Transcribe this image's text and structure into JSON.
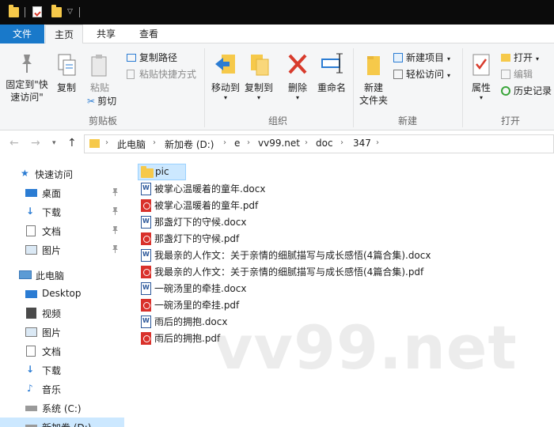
{
  "ribbon_tabs": {
    "file": "文件",
    "home": "主页",
    "share": "共享",
    "view": "查看"
  },
  "ribbon": {
    "clipboard": {
      "pin_label_1": "固定到\"快",
      "pin_label_2": "速访问\"",
      "copy": "复制",
      "paste": "粘贴",
      "copy_path": "复制路径",
      "paste_shortcut": "粘贴快捷方式",
      "cut": "剪切",
      "group": "剪贴板"
    },
    "organize": {
      "move_to": "移动到",
      "copy_to": "复制到",
      "delete": "删除",
      "rename": "重命名",
      "group": "组织"
    },
    "new": {
      "new_folder_1": "新建",
      "new_folder_2": "文件夹",
      "new_item": "新建项目",
      "easy_access": "轻松访问",
      "group": "新建"
    },
    "open": {
      "properties": "属性",
      "open": "打开",
      "edit": "编辑",
      "history": "历史记录",
      "group": "打开"
    }
  },
  "breadcrumbs": [
    "此电脑",
    "新加卷 (D:)",
    "e",
    "vv99.net",
    "doc",
    "347"
  ],
  "nav_pane": {
    "quick_access": "快速访问",
    "quick_items": [
      "桌面",
      "下载",
      "文档",
      "图片"
    ],
    "this_pc": "此电脑",
    "pc_items": [
      "Desktop",
      "视频",
      "图片",
      "文档",
      "下载",
      "音乐",
      "系统 (C:)",
      "新加卷 (D:)"
    ]
  },
  "files": [
    {
      "name": "pic",
      "type": "folder"
    },
    {
      "name": "被掌心温暖着的童年.docx",
      "type": "docx"
    },
    {
      "name": "被掌心温暖着的童年.pdf",
      "type": "pdf"
    },
    {
      "name": "那盏灯下的守候.docx",
      "type": "docx"
    },
    {
      "name": "那盏灯下的守候.pdf",
      "type": "pdf"
    },
    {
      "name": "我最亲的人作文：关于亲情的细腻描写与成长感悟(4篇合集).docx",
      "type": "docx"
    },
    {
      "name": "我最亲的人作文：关于亲情的细腻描写与成长感悟(4篇合集).pdf",
      "type": "pdf"
    },
    {
      "name": "一碗汤里的牵挂.docx",
      "type": "docx"
    },
    {
      "name": "一碗汤里的牵挂.pdf",
      "type": "pdf"
    },
    {
      "name": "雨后的拥抱.docx",
      "type": "docx"
    },
    {
      "name": "雨后的拥抱.pdf",
      "type": "pdf"
    }
  ],
  "watermark": "vv99.net"
}
